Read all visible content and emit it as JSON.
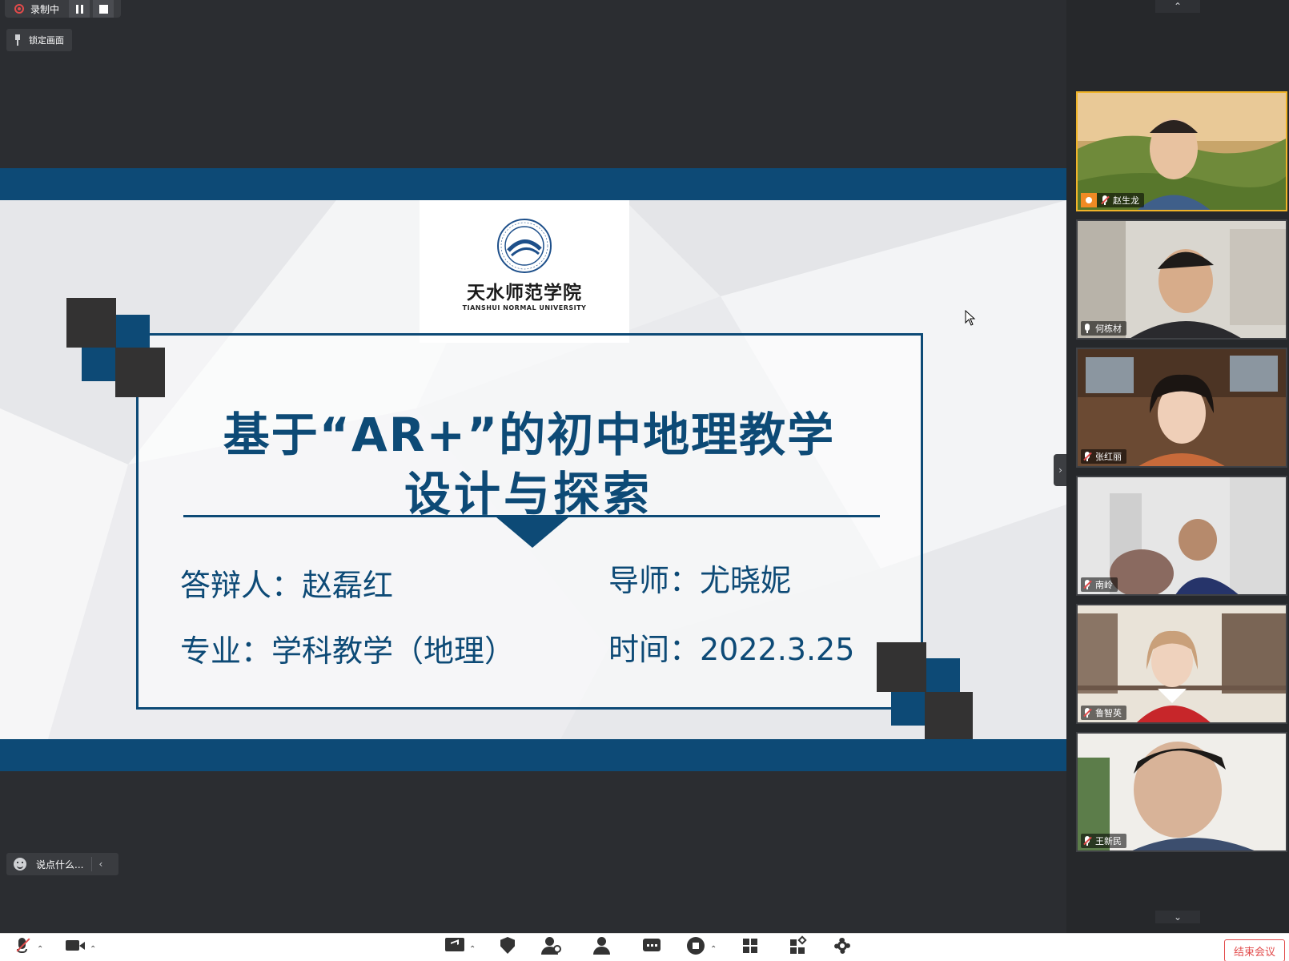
{
  "recording": {
    "label": "录制中"
  },
  "lock_screen": {
    "label": "锁定画面"
  },
  "slide": {
    "university_cn": "天水师范学院",
    "university_en": "TIANSHUI NORMAL UNIVERSITY",
    "title_line1": "基于“AR+”的初中地理教学",
    "title_line2": "设计与探索",
    "defender": "答辩人：赵磊红",
    "advisor": "导师：尤晓妮",
    "major": "专业：学科教学（地理）",
    "date": "时间：2022.3.25"
  },
  "participants": [
    {
      "name": "赵生龙",
      "host": true,
      "muted": true
    },
    {
      "name": "何栋材",
      "host": false,
      "muted": false
    },
    {
      "name": "张红丽",
      "host": false,
      "muted": true
    },
    {
      "name": "南岭",
      "host": false,
      "muted": true
    },
    {
      "name": "鲁智英",
      "host": false,
      "muted": true
    },
    {
      "name": "王新民",
      "host": false,
      "muted": true
    }
  ],
  "chat": {
    "placeholder": "说点什么..."
  },
  "toolbar": {
    "end_meeting": "结束会议"
  },
  "colors": {
    "slide_blue": "#0d4a76",
    "dark_square": "#333232",
    "record_red": "#e24b4b",
    "host_orange": "#f08a24"
  }
}
